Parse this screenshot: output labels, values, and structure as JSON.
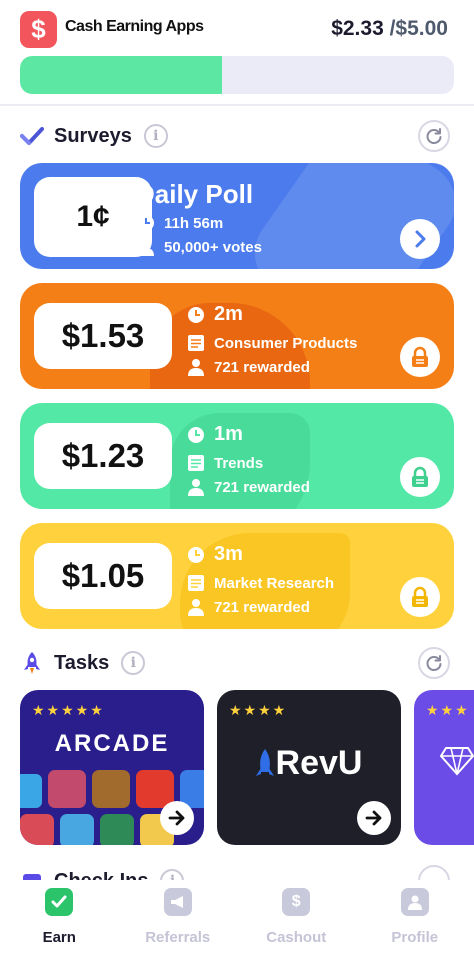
{
  "header": {
    "app_title": "Cash Earning Apps",
    "logo_icon": "dollar-icon",
    "balance_current": "$2.33",
    "balance_goal": " /$5.00",
    "progress_fraction": 0.466,
    "progress_color": "#5ce8a3"
  },
  "surveys": {
    "title": "Surveys",
    "info_label": "i",
    "cards": [
      {
        "price": "1¢",
        "title": "Daily Poll",
        "time": "11h 56m",
        "votes": "50,000+ votes",
        "color": "#4b7bec",
        "action_icon": "chevron-right-icon"
      },
      {
        "price": "$1.53",
        "time": "2m",
        "category": "Consumer Products",
        "rewarded": "721 rewarded",
        "color": "#f57f17",
        "action_icon": "lock-icon"
      },
      {
        "price": "$1.23",
        "time": "1m",
        "category": "Trends",
        "rewarded": "721 rewarded",
        "color": "#54e8a6",
        "action_icon": "lock-icon"
      },
      {
        "price": "$1.05",
        "time": "3m",
        "category": "Market Research",
        "rewarded": "721 rewarded",
        "color": "#ffd23d",
        "action_icon": "lock-icon"
      }
    ]
  },
  "tasks": {
    "title": "Tasks",
    "info_label": "i",
    "items": [
      {
        "name": "ARCADE",
        "stars": "★★★★★",
        "color": "#2a1d8c"
      },
      {
        "name": "RevU",
        "stars": "★★★★",
        "color": "#1f1f29"
      },
      {
        "name": "",
        "stars": "★★★",
        "color": "#6b4ce6"
      }
    ]
  },
  "check_ins": {
    "title": "Check Ins"
  },
  "nav": {
    "items": [
      {
        "label": "Earn",
        "icon": "check-icon",
        "active": true
      },
      {
        "label": "Referrals",
        "icon": "megaphone-icon",
        "active": false
      },
      {
        "label": "Cashout",
        "icon": "dollar-icon",
        "active": false
      },
      {
        "label": "Profile",
        "icon": "person-icon",
        "active": false
      }
    ]
  }
}
